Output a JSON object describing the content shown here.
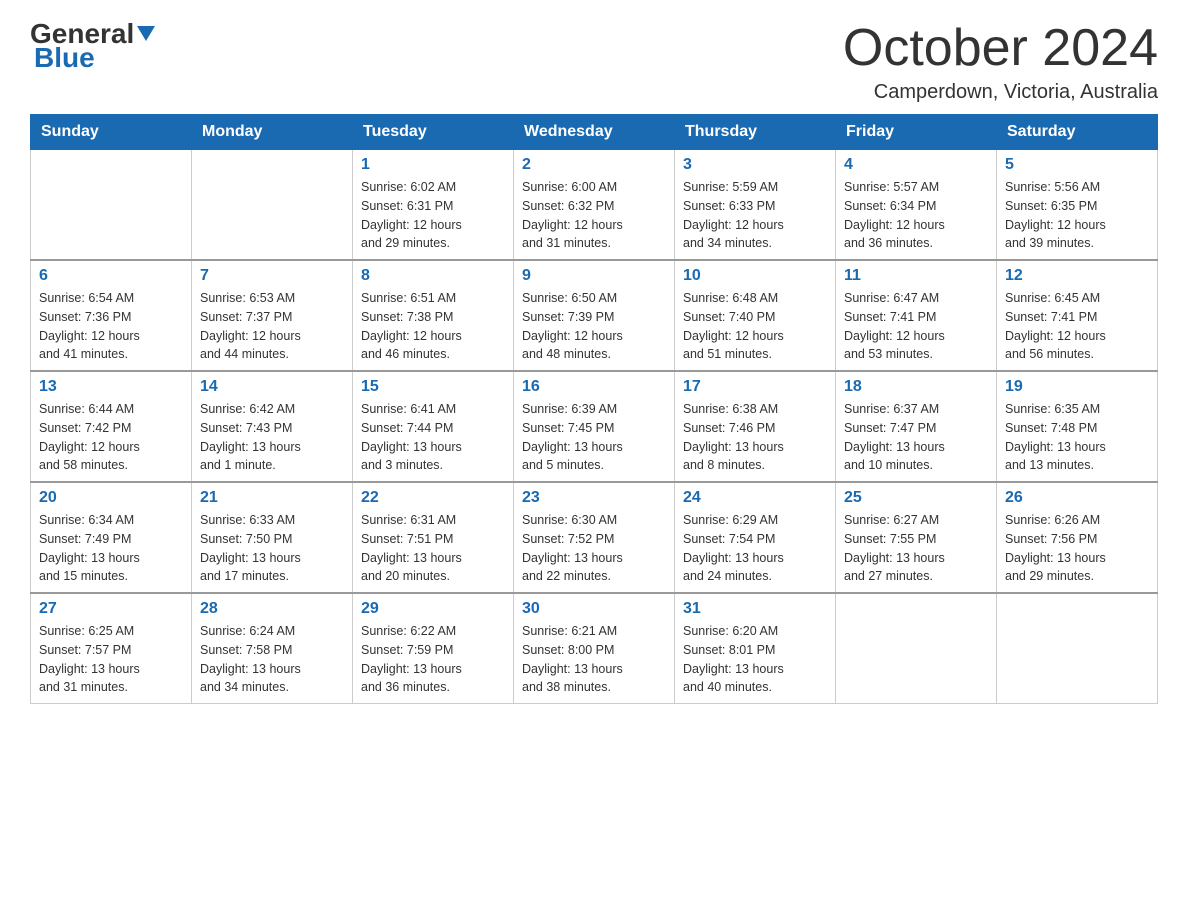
{
  "header": {
    "logo": {
      "general": "General",
      "arrow": "▼",
      "blue": "Blue"
    },
    "title": "October 2024",
    "location": "Camperdown, Victoria, Australia"
  },
  "days_of_week": [
    "Sunday",
    "Monday",
    "Tuesday",
    "Wednesday",
    "Thursday",
    "Friday",
    "Saturday"
  ],
  "weeks": [
    [
      {
        "day": "",
        "info": ""
      },
      {
        "day": "",
        "info": ""
      },
      {
        "day": "1",
        "info": "Sunrise: 6:02 AM\nSunset: 6:31 PM\nDaylight: 12 hours\nand 29 minutes."
      },
      {
        "day": "2",
        "info": "Sunrise: 6:00 AM\nSunset: 6:32 PM\nDaylight: 12 hours\nand 31 minutes."
      },
      {
        "day": "3",
        "info": "Sunrise: 5:59 AM\nSunset: 6:33 PM\nDaylight: 12 hours\nand 34 minutes."
      },
      {
        "day": "4",
        "info": "Sunrise: 5:57 AM\nSunset: 6:34 PM\nDaylight: 12 hours\nand 36 minutes."
      },
      {
        "day": "5",
        "info": "Sunrise: 5:56 AM\nSunset: 6:35 PM\nDaylight: 12 hours\nand 39 minutes."
      }
    ],
    [
      {
        "day": "6",
        "info": "Sunrise: 6:54 AM\nSunset: 7:36 PM\nDaylight: 12 hours\nand 41 minutes."
      },
      {
        "day": "7",
        "info": "Sunrise: 6:53 AM\nSunset: 7:37 PM\nDaylight: 12 hours\nand 44 minutes."
      },
      {
        "day": "8",
        "info": "Sunrise: 6:51 AM\nSunset: 7:38 PM\nDaylight: 12 hours\nand 46 minutes."
      },
      {
        "day": "9",
        "info": "Sunrise: 6:50 AM\nSunset: 7:39 PM\nDaylight: 12 hours\nand 48 minutes."
      },
      {
        "day": "10",
        "info": "Sunrise: 6:48 AM\nSunset: 7:40 PM\nDaylight: 12 hours\nand 51 minutes."
      },
      {
        "day": "11",
        "info": "Sunrise: 6:47 AM\nSunset: 7:41 PM\nDaylight: 12 hours\nand 53 minutes."
      },
      {
        "day": "12",
        "info": "Sunrise: 6:45 AM\nSunset: 7:41 PM\nDaylight: 12 hours\nand 56 minutes."
      }
    ],
    [
      {
        "day": "13",
        "info": "Sunrise: 6:44 AM\nSunset: 7:42 PM\nDaylight: 12 hours\nand 58 minutes."
      },
      {
        "day": "14",
        "info": "Sunrise: 6:42 AM\nSunset: 7:43 PM\nDaylight: 13 hours\nand 1 minute."
      },
      {
        "day": "15",
        "info": "Sunrise: 6:41 AM\nSunset: 7:44 PM\nDaylight: 13 hours\nand 3 minutes."
      },
      {
        "day": "16",
        "info": "Sunrise: 6:39 AM\nSunset: 7:45 PM\nDaylight: 13 hours\nand 5 minutes."
      },
      {
        "day": "17",
        "info": "Sunrise: 6:38 AM\nSunset: 7:46 PM\nDaylight: 13 hours\nand 8 minutes."
      },
      {
        "day": "18",
        "info": "Sunrise: 6:37 AM\nSunset: 7:47 PM\nDaylight: 13 hours\nand 10 minutes."
      },
      {
        "day": "19",
        "info": "Sunrise: 6:35 AM\nSunset: 7:48 PM\nDaylight: 13 hours\nand 13 minutes."
      }
    ],
    [
      {
        "day": "20",
        "info": "Sunrise: 6:34 AM\nSunset: 7:49 PM\nDaylight: 13 hours\nand 15 minutes."
      },
      {
        "day": "21",
        "info": "Sunrise: 6:33 AM\nSunset: 7:50 PM\nDaylight: 13 hours\nand 17 minutes."
      },
      {
        "day": "22",
        "info": "Sunrise: 6:31 AM\nSunset: 7:51 PM\nDaylight: 13 hours\nand 20 minutes."
      },
      {
        "day": "23",
        "info": "Sunrise: 6:30 AM\nSunset: 7:52 PM\nDaylight: 13 hours\nand 22 minutes."
      },
      {
        "day": "24",
        "info": "Sunrise: 6:29 AM\nSunset: 7:54 PM\nDaylight: 13 hours\nand 24 minutes."
      },
      {
        "day": "25",
        "info": "Sunrise: 6:27 AM\nSunset: 7:55 PM\nDaylight: 13 hours\nand 27 minutes."
      },
      {
        "day": "26",
        "info": "Sunrise: 6:26 AM\nSunset: 7:56 PM\nDaylight: 13 hours\nand 29 minutes."
      }
    ],
    [
      {
        "day": "27",
        "info": "Sunrise: 6:25 AM\nSunset: 7:57 PM\nDaylight: 13 hours\nand 31 minutes."
      },
      {
        "day": "28",
        "info": "Sunrise: 6:24 AM\nSunset: 7:58 PM\nDaylight: 13 hours\nand 34 minutes."
      },
      {
        "day": "29",
        "info": "Sunrise: 6:22 AM\nSunset: 7:59 PM\nDaylight: 13 hours\nand 36 minutes."
      },
      {
        "day": "30",
        "info": "Sunrise: 6:21 AM\nSunset: 8:00 PM\nDaylight: 13 hours\nand 38 minutes."
      },
      {
        "day": "31",
        "info": "Sunrise: 6:20 AM\nSunset: 8:01 PM\nDaylight: 13 hours\nand 40 minutes."
      },
      {
        "day": "",
        "info": ""
      },
      {
        "day": "",
        "info": ""
      }
    ]
  ]
}
